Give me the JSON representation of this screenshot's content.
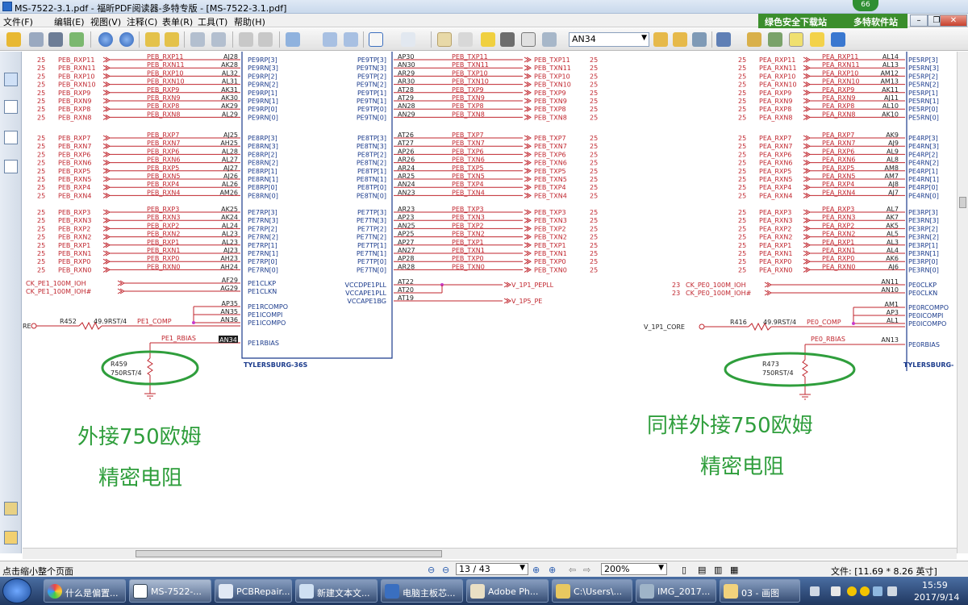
{
  "window": {
    "title": "MS-7522-3.1.pdf - 福昕PDF阅读器-多特专版 - [MS-7522-3.1.pdf]",
    "badge": "66"
  },
  "menu": [
    "文件(F)",
    "编辑(E)",
    "视图(V)",
    "注释(C)",
    "表单(R)",
    "工具(T)",
    "帮助(H)"
  ],
  "ad": {
    "label1": "绿色安全下载站",
    "label2": "多特软件站"
  },
  "search": {
    "value": "AN34"
  },
  "status": {
    "left": "点击缩小整个页面",
    "page": "13 / 43",
    "zoom": "200%",
    "filesize": "文件: [11.69 * 8.26 英寸]"
  },
  "taskbar": {
    "items": [
      "什么是偏置...",
      "MS-7522-...",
      "PCBRepair...",
      "新建文本文...",
      "电脑主板芯...",
      "Adobe Ph...",
      "C:\\Users\\...",
      "IMG_2017...",
      "03 - 画图"
    ],
    "time": "15:59",
    "date": "2017/9/14"
  },
  "colors": {
    "wire": "#c0262e",
    "frame": "#1b3b8c",
    "ellipse": "#2f9e3c",
    "annotation": "#2f9e3c"
  },
  "schematic": {
    "left_groups": [
      {
        "rows": [
          [
            "25",
            "PEB_RXP11",
            "PEB_RXP11",
            "AJ28",
            "PE9RP[3]"
          ],
          [
            "25",
            "PEB_RXN11",
            "PEB_RXN11",
            "AK28",
            "PE9RN[3]"
          ],
          [
            "25",
            "PEB_RXP10",
            "PEB_RXP10",
            "AL32",
            "PE9RP[2]"
          ],
          [
            "25",
            "PEB_RXN10",
            "PEB_RXN10",
            "AL31",
            "PE9RN[2]"
          ],
          [
            "25",
            "PEB_RXP9",
            "PEB_RXP9",
            "AK31",
            "PE9RP[1]"
          ],
          [
            "25",
            "PEB_RXN9",
            "PEB_RXN9",
            "AK30",
            "PE9RN[1]"
          ],
          [
            "25",
            "PEB_RXP8",
            "PEB_RXP8",
            "AK29",
            "PE9RP[0]"
          ],
          [
            "25",
            "PEB_RXN8",
            "PEB_RXN8",
            "AL29",
            "PE9RN[0]"
          ]
        ]
      },
      {
        "rows": [
          [
            "25",
            "PEB_RXP7",
            "PEB_RXP7",
            "AJ25",
            "PE8RP[3]"
          ],
          [
            "25",
            "PEB_RXN7",
            "PEB_RXN7",
            "AH25",
            "PE8RN[3]"
          ],
          [
            "25",
            "PEB_RXP6",
            "PEB_RXP6",
            "AL28",
            "PE8RP[2]"
          ],
          [
            "25",
            "PEB_RXN6",
            "PEB_RXN6",
            "AL27",
            "PE8RN[2]"
          ],
          [
            "25",
            "PEB_RXP5",
            "PEB_RXP5",
            "AJ27",
            "PE8RP[1]"
          ],
          [
            "25",
            "PEB_RXN5",
            "PEB_RXN5",
            "AJ26",
            "PE8RN[1]"
          ],
          [
            "25",
            "PEB_RXP4",
            "PEB_RXP4",
            "AL26",
            "PE8RP[0]"
          ],
          [
            "25",
            "PEB_RXN4",
            "PEB_RXN4",
            "AM26",
            "PE8RN[0]"
          ]
        ]
      },
      {
        "rows": [
          [
            "25",
            "PEB_RXP3",
            "PEB_RXP3",
            "AK25",
            "PE7RP[3]"
          ],
          [
            "25",
            "PEB_RXN3",
            "PEB_RXN3",
            "AK24",
            "PE7RN[3]"
          ],
          [
            "25",
            "PEB_RXP2",
            "PEB_RXP2",
            "AL24",
            "PE7RP[2]"
          ],
          [
            "25",
            "PEB_RXN2",
            "PEB_RXN2",
            "AL23",
            "PE7RN[2]"
          ],
          [
            "25",
            "PEB_RXP1",
            "PEB_RXP1",
            "AL23",
            "PE7RP[1]"
          ],
          [
            "25",
            "PEB_RXN1",
            "PEB_RXN1",
            "AJ23",
            "PE7RN[1]"
          ],
          [
            "25",
            "PEB_RXP0",
            "PEB_RXP0",
            "AH23",
            "PE7RP[0]"
          ],
          [
            "25",
            "PEB_RXN0",
            "PEB_RXN0",
            "AH24",
            "PE7RN[0]"
          ]
        ]
      }
    ],
    "mid_groups": [
      {
        "rows": [
          [
            "PE9TP[3]",
            "AP30",
            "PEB_TXP11",
            "PEB_TXP11",
            "25"
          ],
          [
            "PE9TN[3]",
            "AN30",
            "PEB_TXN11",
            "PEB_TXN11",
            "25"
          ],
          [
            "PE9TP[2]",
            "AR29",
            "PEB_TXP10",
            "PEB_TXP10",
            "25"
          ],
          [
            "PE9TN[2]",
            "AR30",
            "PEB_TXN10",
            "PEB_TXN10",
            "25"
          ],
          [
            "PE9TP[1]",
            "AT28",
            "PEB_TXP9",
            "PEB_TXP9",
            "25"
          ],
          [
            "PE9TN[1]",
            "AT29",
            "PEB_TXN9",
            "PEB_TXN9",
            "25"
          ],
          [
            "PE9TP[0]",
            "AN28",
            "PEB_TXP8",
            "PEB_TXP8",
            "25"
          ],
          [
            "PE9TN[0]",
            "AN29",
            "PEB_TXN8",
            "PEB_TXN8",
            "25"
          ]
        ]
      },
      {
        "rows": [
          [
            "PE8TP[3]",
            "AT26",
            "PEB_TXP7",
            "PEB_TXP7",
            "25"
          ],
          [
            "PE8TN[3]",
            "AT27",
            "PEB_TXN7",
            "PEB_TXN7",
            "25"
          ],
          [
            "PE8TP[2]",
            "AP26",
            "PEB_TXP6",
            "PEB_TXP6",
            "25"
          ],
          [
            "PE8TN[2]",
            "AR26",
            "PEB_TXN6",
            "PEB_TXN6",
            "25"
          ],
          [
            "PE8TP[1]",
            "AR24",
            "PEB_TXP5",
            "PEB_TXP5",
            "25"
          ],
          [
            "PE8TN[1]",
            "AR25",
            "PEB_TXN5",
            "PEB_TXN5",
            "25"
          ],
          [
            "PE8TP[0]",
            "AN24",
            "PEB_TXP4",
            "PEB_TXP4",
            "25"
          ],
          [
            "PE8TN[0]",
            "AN23",
            "PEB_TXN4",
            "PEB_TXN4",
            "25"
          ]
        ]
      },
      {
        "rows": [
          [
            "PE7TP[3]",
            "AR23",
            "PEB_TXP3",
            "PEB_TXP3",
            "25"
          ],
          [
            "PE7TN[3]",
            "AP23",
            "PEB_TXN3",
            "PEB_TXN3",
            "25"
          ],
          [
            "PE7TP[2]",
            "AN25",
            "PEB_TXP2",
            "PEB_TXP2",
            "25"
          ],
          [
            "PE7TN[2]",
            "AP25",
            "PEB_TXN2",
            "PEB_TXN2",
            "25"
          ],
          [
            "PE7TP[1]",
            "AP27",
            "PEB_TXP1",
            "PEB_TXP1",
            "25"
          ],
          [
            "PE7TN[1]",
            "AN27",
            "PEB_TXN1",
            "PEB_TXN1",
            "25"
          ],
          [
            "PE7TP[0]",
            "AP28",
            "PEB_TXP0",
            "PEB_TXP0",
            "25"
          ],
          [
            "PE7TN[0]",
            "AR28",
            "PEB_TXN0",
            "PEB_TXN0",
            "25"
          ]
        ]
      }
    ],
    "right_groups": [
      {
        "rows": [
          [
            "25",
            "PEA_RXP11",
            "PEA_RXP11",
            "AL14",
            "PE5RP[3]"
          ],
          [
            "25",
            "PEA_RXN11",
            "PEA_RXN11",
            "AL13",
            "PE5RN[3]"
          ],
          [
            "25",
            "PEA_RXP10",
            "PEA_RXP10",
            "AM12",
            "PE5RP[2]"
          ],
          [
            "25",
            "PEA_RXN10",
            "PEA_RXN10",
            "AM13",
            "PE5RN[2]"
          ],
          [
            "25",
            "PEA_RXP9",
            "PEA_RXP9",
            "AK11",
            "PE5RP[1]"
          ],
          [
            "25",
            "PEA_RXN9",
            "PEA_RXN9",
            "AJ11",
            "PE5RN[1]"
          ],
          [
            "25",
            "PEA_RXP8",
            "PEA_RXP8",
            "AL10",
            "PE5RP[0]"
          ],
          [
            "25",
            "PEA_RXN8",
            "PEA_RXN8",
            "AK10",
            "PE5RN[0]"
          ]
        ]
      },
      {
        "rows": [
          [
            "25",
            "PEA_RXP7",
            "PEA_RXP7",
            "AK9",
            "PE4RP[3]"
          ],
          [
            "25",
            "PEA_RXN7",
            "PEA_RXN7",
            "AJ9",
            "PE4RN[3]"
          ],
          [
            "25",
            "PEA_RXP6",
            "PEA_RXP6",
            "AL9",
            "PE4RP[2]"
          ],
          [
            "25",
            "PEA_RXN6",
            "PEA_RXN6",
            "AL8",
            "PE4RN[2]"
          ],
          [
            "25",
            "PEA_RXP5",
            "PEA_RXP5",
            "AM8",
            "PE4RP[1]"
          ],
          [
            "25",
            "PEA_RXN5",
            "PEA_RXN5",
            "AM7",
            "PE4RN[1]"
          ],
          [
            "25",
            "PEA_RXP4",
            "PEA_RXP4",
            "AJ8",
            "PE4RP[0]"
          ],
          [
            "25",
            "PEA_RXN4",
            "PEA_RXN4",
            "AJ7",
            "PE4RN[0]"
          ]
        ]
      },
      {
        "rows": [
          [
            "25",
            "PEA_RXP3",
            "PEA_RXP3",
            "AL7",
            "PE3RP[3]"
          ],
          [
            "25",
            "PEA_RXN3",
            "PEA_RXN3",
            "AK7",
            "PE3RN[3]"
          ],
          [
            "25",
            "PEA_RXP2",
            "PEA_RXP2",
            "AK5",
            "PE3RP[2]"
          ],
          [
            "25",
            "PEA_RXN2",
            "PEA_RXN2",
            "AL5",
            "PE3RN[2]"
          ],
          [
            "25",
            "PEA_RXP1",
            "PEA_RXP1",
            "AL3",
            "PE3RP[1]"
          ],
          [
            "25",
            "PEA_RXN1",
            "PEA_RXN1",
            "AL4",
            "PE3RN[1]"
          ],
          [
            "25",
            "PEA_RXP0",
            "PEA_RXP0",
            "AK6",
            "PE3RP[0]"
          ],
          [
            "25",
            "PEA_RXN0",
            "PEA_RXN0",
            "AJ6",
            "PE3RN[0]"
          ]
        ]
      }
    ],
    "left_clk": [
      [
        "CK_PE1_100M_IOH",
        "AF29",
        "PE1CLKP"
      ],
      [
        "CK_PE1_100M_IOH#",
        "AG29",
        "PE1CLKN"
      ]
    ],
    "right_clk": [
      [
        "23",
        "CK_PE0_100M_IOH",
        "AN11",
        "PE0CLKP"
      ],
      [
        "23",
        "CK_PE0_100M_IOH#",
        "AN10",
        "PE0CLKN"
      ]
    ],
    "left_comp": [
      [
        "AP35",
        "PE1RCOMPO"
      ],
      [
        "AN35",
        "PE1ICOMPI"
      ],
      [
        "AN36",
        "PE1ICOMPO"
      ]
    ],
    "right_comp": [
      [
        "AM1",
        "PE0RCOMPO"
      ],
      [
        "AP3",
        "PE0ICOMPI"
      ],
      [
        "AL1",
        "PE0ICOMPO"
      ]
    ],
    "left_pll": [
      [
        "VCCDPE1PLL",
        "AT22"
      ],
      [
        "VCCAPE1PLL",
        "AT20"
      ],
      [
        "VCCAPE1BG",
        "AT19"
      ]
    ],
    "pll_nets": {
      "a": "V_1P1_PEPLL",
      "b": "V_1P5_PE"
    },
    "left_res": {
      "ref": "R452",
      "val": "49.9RST/4",
      "net": "PE1_COMP",
      "edge": "RE"
    },
    "right_res": {
      "ref": "R416",
      "val": "49.9RST/4",
      "net": "PE0_COMP",
      "src": "V_1P1_CORE"
    },
    "left_bias": {
      "net": "PE1_RBIAS",
      "pin": "AN34",
      "port": "PE1RBIAS",
      "ref": "R459",
      "val": "750RST/4"
    },
    "right_bias": {
      "net": "PE0_RBIAS",
      "pin": "AN13",
      "port": "PE0RBIAS",
      "ref": "R473",
      "val": "750RST/4"
    },
    "chip_name": "TYLERSBURG-36S",
    "chip_name_right": "TYLERSBURG-"
  },
  "annotations": {
    "left1": "外接750欧姆",
    "left2": "精密电阻",
    "right1": "同样外接750欧姆",
    "right2": "精密电阻"
  }
}
